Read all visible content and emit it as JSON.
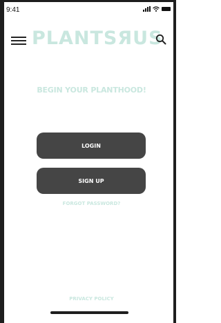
{
  "status_bar": {
    "time": "9:41"
  },
  "header": {
    "brand": "PLANTSЯUS",
    "icons": {
      "menu": "hamburger-menu-icon",
      "search": "search-icon"
    }
  },
  "main": {
    "tagline": "BEGIN YOUR PLANTHOOD!",
    "login_label": "LOGIN",
    "signup_label": "SIGN UP",
    "forgot_label": "FORGOT PASSWORD?"
  },
  "footer": {
    "privacy_label": "PRIVACY POLICY"
  },
  "colors": {
    "accent": "#c9e7df",
    "button": "#454545",
    "button_text": "#ffffff"
  }
}
